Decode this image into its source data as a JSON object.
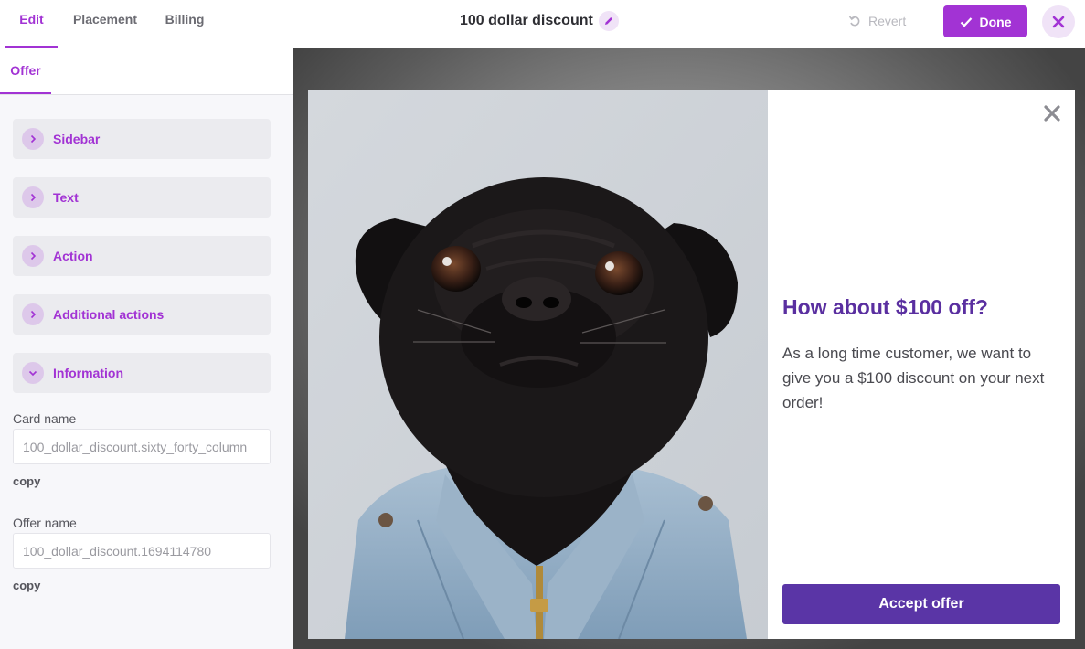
{
  "header": {
    "tabs": [
      {
        "label": "Edit",
        "active": true
      },
      {
        "label": "Placement",
        "active": false
      },
      {
        "label": "Billing",
        "active": false
      }
    ],
    "title": "100 dollar discount",
    "title_edit_icon": "pencil-icon",
    "revert_label": "Revert",
    "revert_icon": "undo-icon",
    "done_label": "Done",
    "done_icon": "check-icon",
    "close_icon": "close-icon"
  },
  "sidebar": {
    "subtab": "Offer",
    "sections": [
      {
        "label": "Sidebar",
        "expanded": false
      },
      {
        "label": "Text",
        "expanded": false
      },
      {
        "label": "Action",
        "expanded": false
      },
      {
        "label": "Additional actions",
        "expanded": false
      },
      {
        "label": "Information",
        "expanded": true
      }
    ],
    "card_name": {
      "label": "Card name",
      "value": "100_dollar_discount.sixty_forty_column",
      "copy_label": "copy"
    },
    "offer_name": {
      "label": "Offer name",
      "value": "100_dollar_discount.1694114780",
      "copy_label": "copy"
    }
  },
  "preview": {
    "image_subject": "pug-in-denim-jacket-photo",
    "close_icon": "close-icon",
    "heading": "How about $100 off?",
    "body": "As a long time customer, we want to give you a $100 discount on your next order!",
    "accept_label": "Accept offer"
  },
  "colors": {
    "accent": "#a233d4",
    "accent_light": "#f0e3f7",
    "offer_heading": "#5a2fa0",
    "accept_button": "#5a35a6"
  }
}
